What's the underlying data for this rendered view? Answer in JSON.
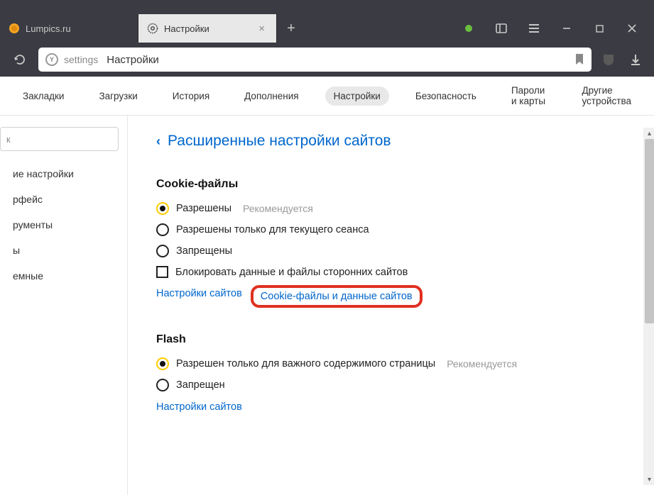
{
  "tabs": [
    {
      "title": "Lumpics.ru"
    },
    {
      "title": "Настройки"
    }
  ],
  "address": {
    "prefix": "settings",
    "title": "Настройки"
  },
  "topnav": {
    "items": [
      "Закладки",
      "Загрузки",
      "История",
      "Дополнения",
      "Настройки",
      "Безопасность",
      "Пароли и карты",
      "Другие устройства"
    ],
    "active": 4
  },
  "sidebar": {
    "search_value": "к",
    "items": [
      "ие настройки",
      "рфейс",
      "рументы",
      "ы",
      "емные"
    ]
  },
  "page_header": "Расширенные настройки сайтов",
  "cookies": {
    "title": "Cookie-файлы",
    "options": [
      {
        "label": "Разрешены",
        "hint": "Рекомендуется",
        "checked": true
      },
      {
        "label": "Разрешены только для текущего сеанса",
        "checked": false
      },
      {
        "label": "Запрещены",
        "checked": false
      }
    ],
    "checkbox_label": "Блокировать данные и файлы сторонних сайтов",
    "link_sites": "Настройки сайтов",
    "link_cookies": "Cookie-файлы и данные сайтов"
  },
  "flash": {
    "title": "Flash",
    "options": [
      {
        "label": "Разрешен только для важного содержимого страницы",
        "hint": "Рекомендуется",
        "checked": true
      },
      {
        "label": "Запрещен",
        "checked": false
      }
    ],
    "link_sites": "Настройки сайтов"
  }
}
